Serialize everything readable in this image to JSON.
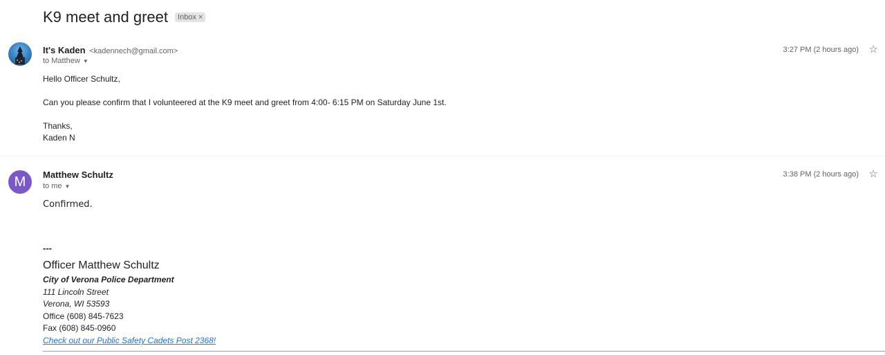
{
  "subject": "K9 meet and greet",
  "label_chip": {
    "text": "Inbox",
    "close": "×"
  },
  "messages": [
    {
      "sender_name": "It's Kaden",
      "sender_email": "<kadennech@gmail.com>",
      "to": "to Matthew",
      "timestamp": "3:27 PM (2 hours ago)",
      "avatar": "photo-avatar",
      "body": [
        "Hello Officer Schultz,",
        "Can you please confirm that I volunteered at the K9 meet and greet from 4:00- 6:15 PM on Saturday June 1st.",
        "Thanks,",
        "Kaden N"
      ]
    },
    {
      "sender_name": "Matthew Schultz",
      "to": "to me",
      "timestamp": "3:38 PM (2 hours ago)",
      "avatar_letter": "M",
      "avatar_color": "#7b57c8",
      "body": [
        "Confirmed."
      ],
      "signature": {
        "dash": "---",
        "name": "Officer Matthew Schultz",
        "department": "City of Verona Police Department",
        "street": "111 Lincoln Street",
        "city": "Verona, WI 53593",
        "office": "Office (608) 845-7623",
        "fax": "Fax (608) 845-0960",
        "link": "Check out our Public Safety Cadets Post 2368!"
      }
    }
  ],
  "icons": {
    "star": "star-icon",
    "caret": "chevron-down-icon"
  }
}
